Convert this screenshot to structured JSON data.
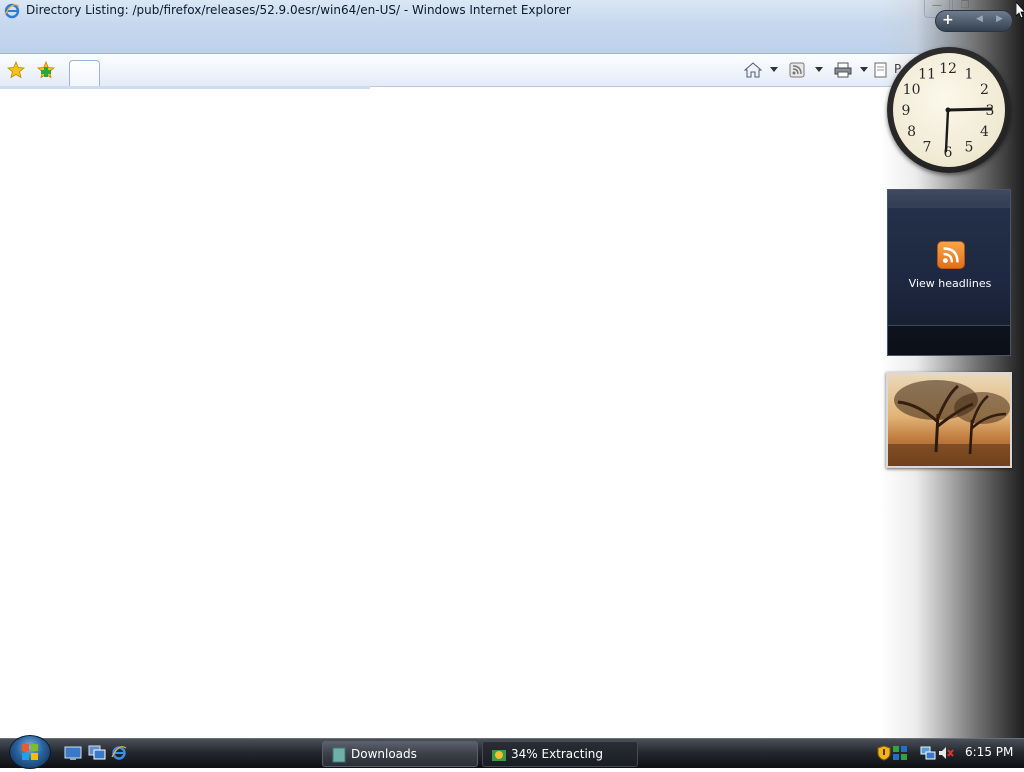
{
  "window": {
    "title": "Directory Listing: /pub/firefox/releases/52.9.0esr/win64/en-US/ - Windows Internet Explorer"
  },
  "command_bar": {
    "page_label": "P"
  },
  "sidebar": {
    "rss": {
      "label": "View headlines"
    },
    "clock": {
      "numbers": [
        "12",
        "1",
        "2",
        "3",
        "4",
        "5",
        "6",
        "7",
        "8",
        "9",
        "10",
        "11"
      ]
    }
  },
  "taskbar": {
    "tasks": [
      {
        "label": "Downloads"
      },
      {
        "label": "34% Extracting"
      }
    ],
    "time": "6:15 PM"
  },
  "colors": {
    "accent": "#1e64b4",
    "rss_orange": "#f08a24"
  }
}
